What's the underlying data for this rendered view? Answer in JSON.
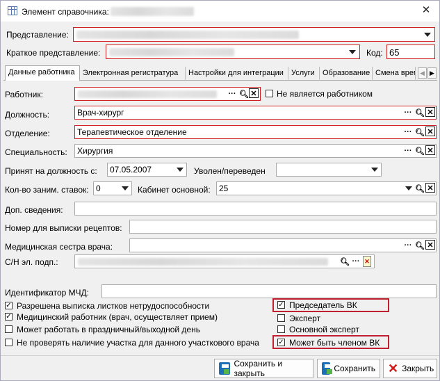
{
  "window": {
    "title": "Элемент справочника:"
  },
  "header": {
    "representation_label": "Представление:",
    "short_label": "Краткое представление:",
    "code_label": "Код:",
    "code_value": "65"
  },
  "tabs": [
    {
      "label": "Данные работника"
    },
    {
      "label": "Электронная регистратура"
    },
    {
      "label": "Настройки для интеграции"
    },
    {
      "label": "Услуги"
    },
    {
      "label": "Образование"
    },
    {
      "label": "Смена врем"
    }
  ],
  "form": {
    "worker_label": "Работник:",
    "not_worker_label": "Не является работником",
    "position_label": "Должность:",
    "position_value": "Врач-хирург",
    "department_label": "Отделение:",
    "department_value": "Терапевтическое отделение",
    "specialty_label": "Специальность:",
    "specialty_value": "Хирургия",
    "hired_label": "Принят на должность с:",
    "hired_value": "07.05.2007",
    "fired_label": "Уволен/переведен",
    "rates_label": "Кол-во заним. ставок:",
    "rates_value": "0",
    "cabinet_label": "Кабинет основной:",
    "cabinet_value": "25",
    "extra_label": "Доп. сведения:",
    "recipe_label": "Номер для выписки рецептов:",
    "nurse_label": "Медицинская сестра врача:",
    "sn_label": "С/Н эл. подп.:",
    "mchd_label": "Идентификатор МЧД:"
  },
  "checks": {
    "sick_leave": {
      "label": "Разрешена выписка листков нетрудоспособности",
      "checked": true
    },
    "medical": {
      "label": "Медицинский работник (врач, осуществляет прием)",
      "checked": true
    },
    "holiday": {
      "label": "Может работать в праздничный/выходной день",
      "checked": false
    },
    "no_check_area": {
      "label": "Не проверять наличие участка для данного участкового врача",
      "checked": false
    },
    "chairman": {
      "label": "Председатель ВК",
      "checked": true
    },
    "expert": {
      "label": "Эксперт",
      "checked": false
    },
    "main_expert": {
      "label": "Основной эксперт",
      "checked": false
    },
    "vk_member": {
      "label": "Может быть членом ВК",
      "checked": true
    }
  },
  "footer": {
    "save_close": "Сохранить и закрыть",
    "save": "Сохранить",
    "close": "Закрыть"
  }
}
